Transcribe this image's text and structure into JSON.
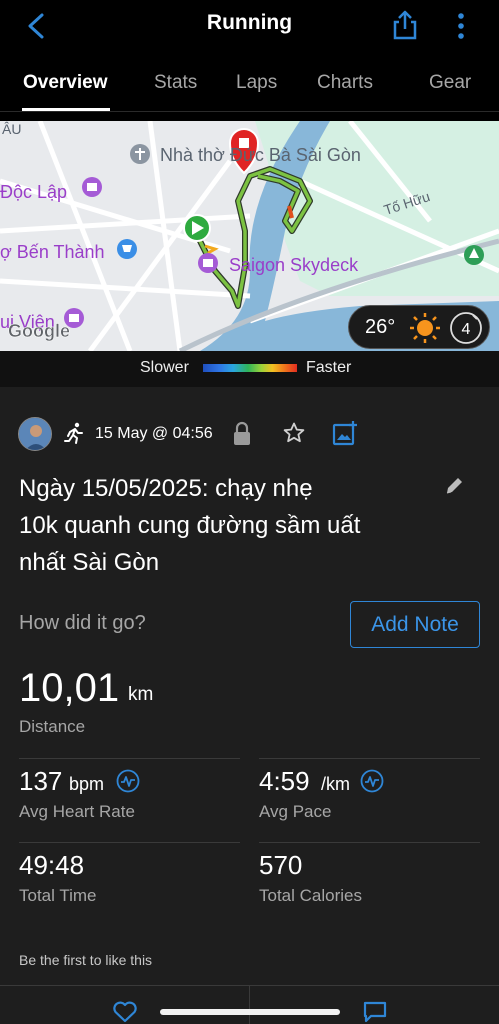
{
  "header": {
    "title": "Running"
  },
  "tabs": [
    {
      "label": "Overview",
      "active": true
    },
    {
      "label": "Stats"
    },
    {
      "label": "Laps"
    },
    {
      "label": "Charts"
    },
    {
      "label": "Gear"
    }
  ],
  "map": {
    "labels": {
      "au": "ÂU",
      "cathedral": "Nhà thờ Đức Bà Sài Gòn",
      "doc_lap": "Độc Lập",
      "ben_thanh": "ợ Bến Thành",
      "skydeck": "Saigon Skydeck",
      "to_huu": "Tố Hữu",
      "vien": "ui Viện",
      "google": "Google"
    },
    "weather": {
      "temperature": "26°",
      "wind": "4"
    }
  },
  "pace_legend": {
    "slower": "Slower",
    "faster": "Faster"
  },
  "activity": {
    "date": "15 May @ 04:56",
    "title": "Ngày 15/05/2025: chạy nhẹ 10k quanh cung đường sầm uất nhất Sài Gòn",
    "title_lines": [
      "Ngày 15/05/2025: chạy nhẹ",
      "10k quanh cung đường sầm uất",
      "nhất Sài Gòn"
    ],
    "how_prompt": "How did it go?",
    "add_note": "Add Note"
  },
  "stats": {
    "distance": {
      "value": "10,01",
      "unit": "km",
      "label": "Distance"
    },
    "heart_rate": {
      "value": "137",
      "unit": "bpm",
      "label": "Avg Heart Rate"
    },
    "pace": {
      "value": "4:59",
      "unit": "/km",
      "label": "Avg Pace"
    },
    "time": {
      "value": "49:48",
      "label": "Total Time"
    },
    "calories": {
      "value": "570",
      "label": "Total Calories"
    }
  },
  "social": {
    "first_like": "Be the first to like this"
  },
  "colors": {
    "accent": "#3b95e8",
    "background": "#1e1e1e",
    "route": "#7cc242",
    "start": "#2eaa3f",
    "end": "#e02424"
  }
}
